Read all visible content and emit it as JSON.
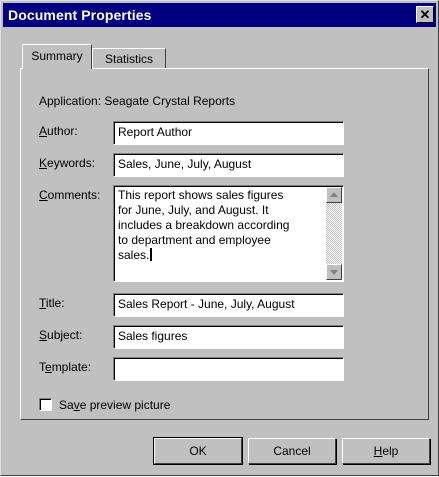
{
  "window": {
    "title": "Document Properties",
    "close_glyph": "✕"
  },
  "tabs": [
    {
      "label": "Summary",
      "active": true
    },
    {
      "label": "Statistics",
      "active": false
    }
  ],
  "application": {
    "text": "Application: Seagate Crystal Reports"
  },
  "fields": {
    "author": {
      "label_rest": "uthor:",
      "mnemonic": "A",
      "value": "Report Author"
    },
    "keywords": {
      "label_rest": "eywords:",
      "mnemonic": "K",
      "value": "Sales, June, July, August"
    },
    "comments": {
      "label_rest": "omments:",
      "mnemonic": "C",
      "value": "This report shows sales figures\nfor June, July, and August. It\nincludes a breakdown according\nto department and employee\nsales."
    },
    "title": {
      "label_rest": "itle:",
      "mnemonic": "T",
      "value": "Sales Report - June, July, August"
    },
    "subject": {
      "label_rest": "ubject:",
      "mnemonic": "S",
      "value": "Sales figures"
    },
    "template": {
      "label_pre": "T",
      "mnemonic": "e",
      "label_rest": "mplate:",
      "value": ""
    }
  },
  "save_preview": {
    "label_pre": "Sa",
    "mnemonic": "v",
    "label_rest": "e preview picture",
    "checked": false
  },
  "buttons": {
    "ok": "OK",
    "cancel": "Cancel",
    "help_mnemonic": "H",
    "help_rest": "elp"
  },
  "icons": {
    "close": "close-icon",
    "scroll_up": "scroll-up-arrow-icon",
    "scroll_down": "scroll-down-arrow-icon"
  },
  "colors": {
    "titlebar": "#000080",
    "face": "#c0c0c0",
    "field": "#ffffff"
  }
}
